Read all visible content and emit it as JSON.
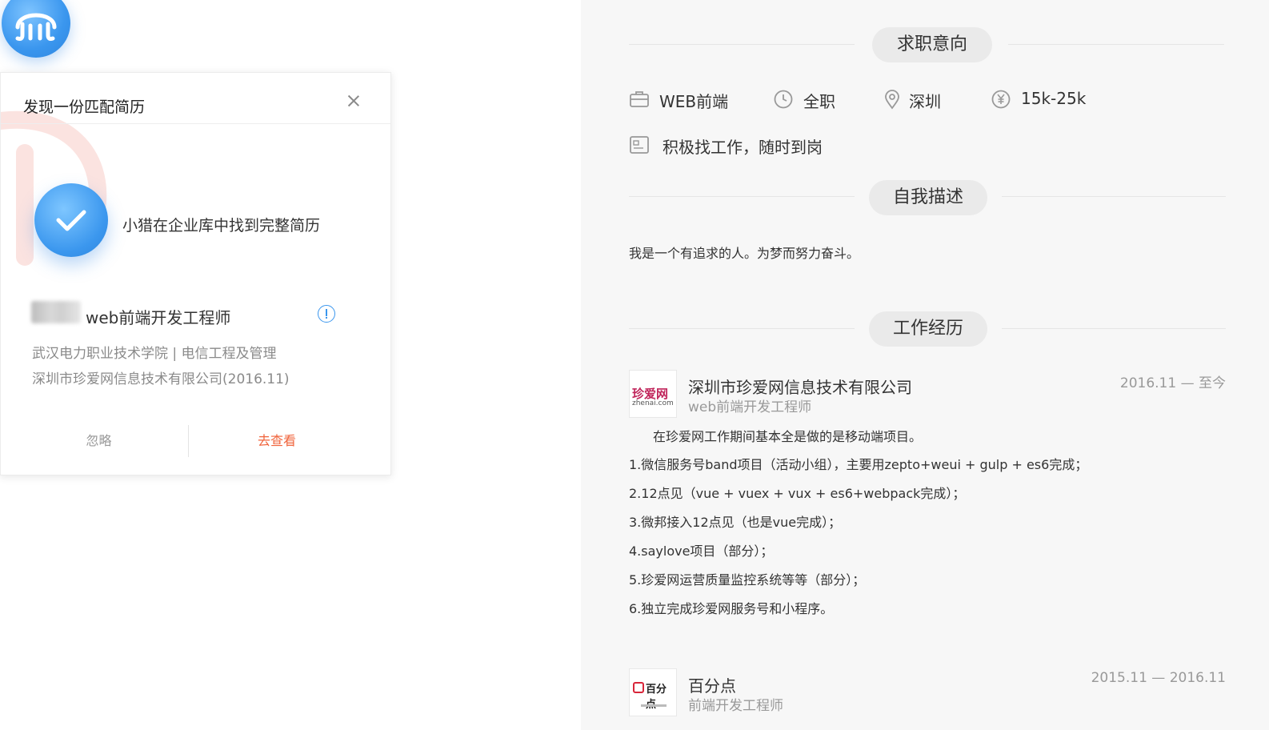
{
  "popup": {
    "title": "发现一份匹配简历",
    "found_text": "小猎在企业库中找到完整简历",
    "candidate_title": "web前端开发工程师",
    "candidate_line1": "武汉电力职业技术学院 | 电信工程及管理",
    "candidate_line2": "深圳市珍爱网信息技术有限公司(2016.11)",
    "ignore_label": "忽略",
    "view_label": "去查看"
  },
  "resume": {
    "intent_heading": "求职意向",
    "intent": {
      "position": "WEB前端",
      "job_type": "全职",
      "city": "深圳",
      "salary": "15k-25k",
      "status": "积极找工作，随时到岗"
    },
    "self_heading": "自我描述",
    "self_description": "我是一个有追求的人。为梦而努力奋斗。",
    "work_heading": "工作经历",
    "jobs": [
      {
        "company": "深圳市珍爱网信息技术有限公司",
        "role": "web前端开发工程师",
        "period": "2016.11 — 至今",
        "logo_text": "珍爱网",
        "logo_sub": "zhenai.com",
        "details": [
          "在珍爱网工作期间基本全是做的是移动端项目。",
          "1.微信服务号band项目（活动小组），主要用zepto+weui + gulp + es6完成；",
          "2.12点见（vue + vuex + vux + es6+webpack完成）；",
          "3.微邦接入12点见（也是vue完成）；",
          "4.saylove项目（部分）；",
          "5.珍爱网运营质量监控系统等等（部分）；",
          "6.独立完成珍爱网服务号和小程序。"
        ]
      },
      {
        "company": "百分点",
        "role": "前端开发工程师",
        "period": "2015.11 — 2016.11",
        "logo_text": "百分点"
      }
    ]
  },
  "icons": {
    "brand": "octopus-logo-icon",
    "close": "close-icon",
    "check": "check-icon",
    "info": "info-icon",
    "briefcase": "briefcase-icon",
    "clock": "clock-icon",
    "location": "location-pin-icon",
    "salary": "yen-coin-icon",
    "id_card": "id-card-icon"
  },
  "colors": {
    "accent_blue": "#3a96ee",
    "view_orange": "#f0643c",
    "right_bg": "#f7f7f7"
  }
}
